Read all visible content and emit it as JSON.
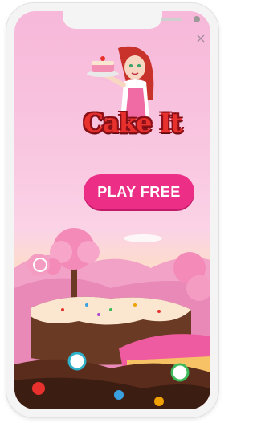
{
  "app": {
    "title": "Cake It",
    "play_label": "PLAY FREE",
    "close_glyph": "×"
  },
  "colors": {
    "play_button": "#ec2e86",
    "logo_red": "#e8302d",
    "background_top": "#f7b8d9",
    "background_bottom": "#f6d7a4"
  },
  "icons": {
    "close": "close-icon"
  }
}
